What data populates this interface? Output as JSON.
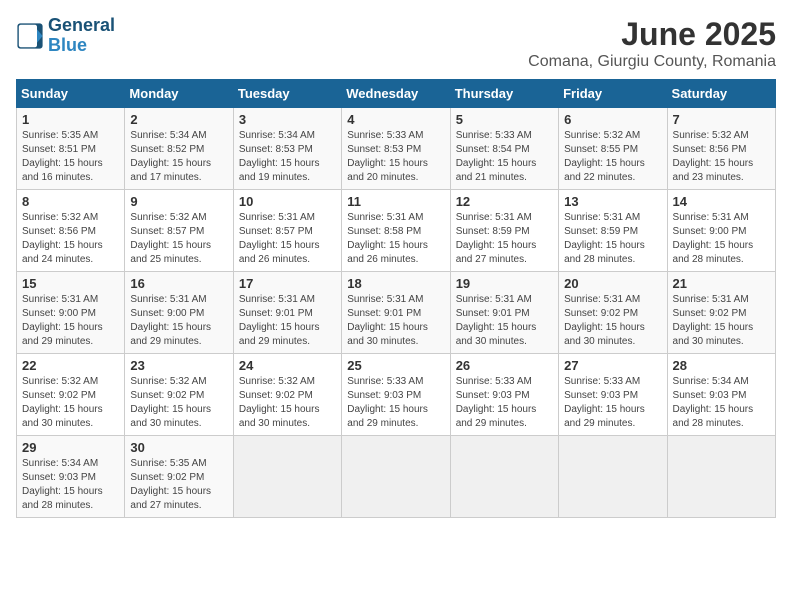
{
  "logo": {
    "line1": "General",
    "line2": "Blue"
  },
  "title": "June 2025",
  "location": "Comana, Giurgiu County, Romania",
  "headers": [
    "Sunday",
    "Monday",
    "Tuesday",
    "Wednesday",
    "Thursday",
    "Friday",
    "Saturday"
  ],
  "weeks": [
    [
      {
        "day": "1",
        "sunrise": "5:35 AM",
        "sunset": "8:51 PM",
        "daylight": "15 hours and 16 minutes."
      },
      {
        "day": "2",
        "sunrise": "5:34 AM",
        "sunset": "8:52 PM",
        "daylight": "15 hours and 17 minutes."
      },
      {
        "day": "3",
        "sunrise": "5:34 AM",
        "sunset": "8:53 PM",
        "daylight": "15 hours and 19 minutes."
      },
      {
        "day": "4",
        "sunrise": "5:33 AM",
        "sunset": "8:53 PM",
        "daylight": "15 hours and 20 minutes."
      },
      {
        "day": "5",
        "sunrise": "5:33 AM",
        "sunset": "8:54 PM",
        "daylight": "15 hours and 21 minutes."
      },
      {
        "day": "6",
        "sunrise": "5:32 AM",
        "sunset": "8:55 PM",
        "daylight": "15 hours and 22 minutes."
      },
      {
        "day": "7",
        "sunrise": "5:32 AM",
        "sunset": "8:56 PM",
        "daylight": "15 hours and 23 minutes."
      }
    ],
    [
      {
        "day": "8",
        "sunrise": "5:32 AM",
        "sunset": "8:56 PM",
        "daylight": "15 hours and 24 minutes."
      },
      {
        "day": "9",
        "sunrise": "5:32 AM",
        "sunset": "8:57 PM",
        "daylight": "15 hours and 25 minutes."
      },
      {
        "day": "10",
        "sunrise": "5:31 AM",
        "sunset": "8:57 PM",
        "daylight": "15 hours and 26 minutes."
      },
      {
        "day": "11",
        "sunrise": "5:31 AM",
        "sunset": "8:58 PM",
        "daylight": "15 hours and 26 minutes."
      },
      {
        "day": "12",
        "sunrise": "5:31 AM",
        "sunset": "8:59 PM",
        "daylight": "15 hours and 27 minutes."
      },
      {
        "day": "13",
        "sunrise": "5:31 AM",
        "sunset": "8:59 PM",
        "daylight": "15 hours and 28 minutes."
      },
      {
        "day": "14",
        "sunrise": "5:31 AM",
        "sunset": "9:00 PM",
        "daylight": "15 hours and 28 minutes."
      }
    ],
    [
      {
        "day": "15",
        "sunrise": "5:31 AM",
        "sunset": "9:00 PM",
        "daylight": "15 hours and 29 minutes."
      },
      {
        "day": "16",
        "sunrise": "5:31 AM",
        "sunset": "9:00 PM",
        "daylight": "15 hours and 29 minutes."
      },
      {
        "day": "17",
        "sunrise": "5:31 AM",
        "sunset": "9:01 PM",
        "daylight": "15 hours and 29 minutes."
      },
      {
        "day": "18",
        "sunrise": "5:31 AM",
        "sunset": "9:01 PM",
        "daylight": "15 hours and 30 minutes."
      },
      {
        "day": "19",
        "sunrise": "5:31 AM",
        "sunset": "9:01 PM",
        "daylight": "15 hours and 30 minutes."
      },
      {
        "day": "20",
        "sunrise": "5:31 AM",
        "sunset": "9:02 PM",
        "daylight": "15 hours and 30 minutes."
      },
      {
        "day": "21",
        "sunrise": "5:31 AM",
        "sunset": "9:02 PM",
        "daylight": "15 hours and 30 minutes."
      }
    ],
    [
      {
        "day": "22",
        "sunrise": "5:32 AM",
        "sunset": "9:02 PM",
        "daylight": "15 hours and 30 minutes."
      },
      {
        "day": "23",
        "sunrise": "5:32 AM",
        "sunset": "9:02 PM",
        "daylight": "15 hours and 30 minutes."
      },
      {
        "day": "24",
        "sunrise": "5:32 AM",
        "sunset": "9:02 PM",
        "daylight": "15 hours and 30 minutes."
      },
      {
        "day": "25",
        "sunrise": "5:33 AM",
        "sunset": "9:03 PM",
        "daylight": "15 hours and 29 minutes."
      },
      {
        "day": "26",
        "sunrise": "5:33 AM",
        "sunset": "9:03 PM",
        "daylight": "15 hours and 29 minutes."
      },
      {
        "day": "27",
        "sunrise": "5:33 AM",
        "sunset": "9:03 PM",
        "daylight": "15 hours and 29 minutes."
      },
      {
        "day": "28",
        "sunrise": "5:34 AM",
        "sunset": "9:03 PM",
        "daylight": "15 hours and 28 minutes."
      }
    ],
    [
      {
        "day": "29",
        "sunrise": "5:34 AM",
        "sunset": "9:03 PM",
        "daylight": "15 hours and 28 minutes."
      },
      {
        "day": "30",
        "sunrise": "5:35 AM",
        "sunset": "9:02 PM",
        "daylight": "15 hours and 27 minutes."
      },
      null,
      null,
      null,
      null,
      null
    ]
  ]
}
